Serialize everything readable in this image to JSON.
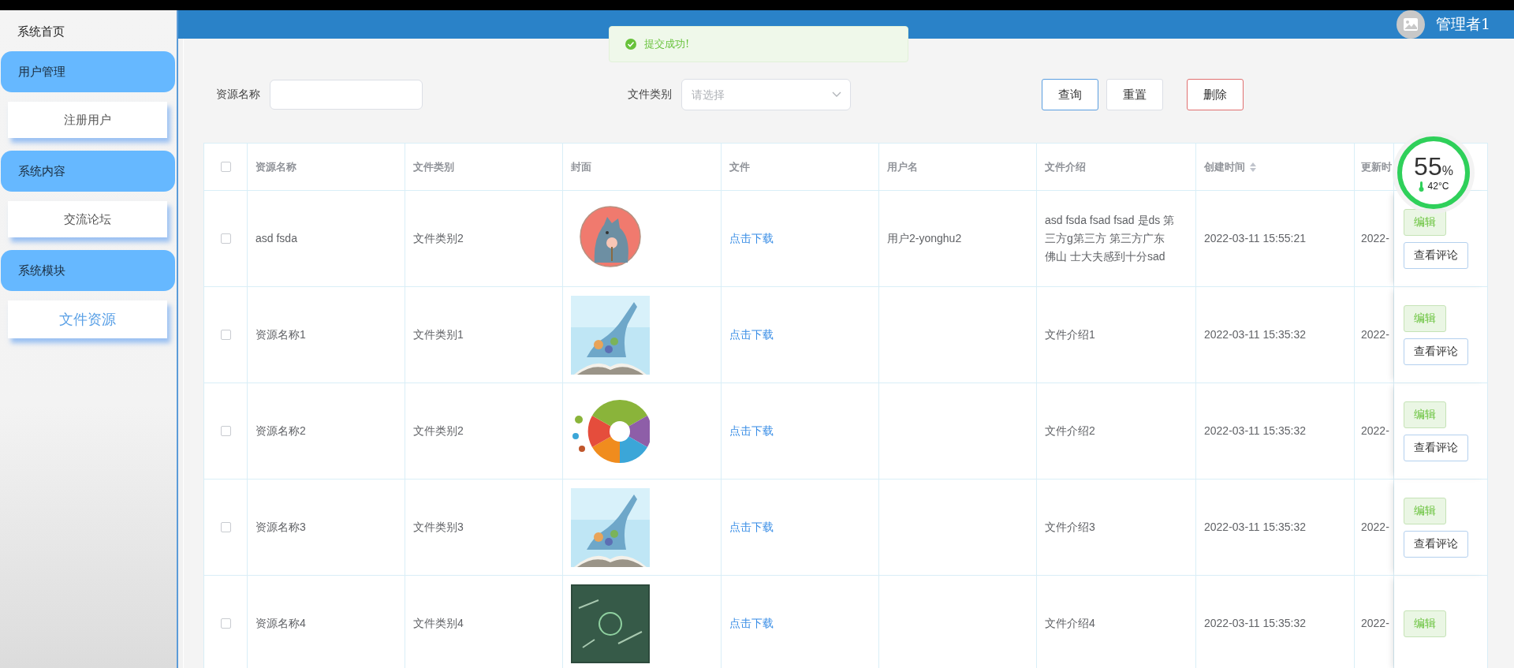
{
  "sidebar": {
    "home": {
      "label": "系统首页"
    },
    "groups": [
      {
        "label": "用户管理",
        "items": [
          {
            "label": "注册用户",
            "selected": false
          }
        ]
      },
      {
        "label": "系统内容",
        "items": [
          {
            "label": "交流论坛",
            "selected": false
          }
        ]
      },
      {
        "label": "系统模块",
        "items": [
          {
            "label": "文件资源",
            "selected": true
          }
        ]
      }
    ]
  },
  "header": {
    "user": "管理者1"
  },
  "toast": {
    "kind": "success",
    "message": "提交成功!"
  },
  "search": {
    "fields": [
      {
        "kind": "text",
        "label": "资源名称"
      },
      {
        "kind": "select",
        "label": "文件类别",
        "placeholder": "请选择"
      }
    ],
    "buttons": [
      {
        "kind": "primary",
        "label": "查询"
      },
      {
        "kind": "default",
        "label": "重置"
      },
      {
        "kind": "danger",
        "label": "删除"
      }
    ]
  },
  "table": {
    "select_all": false,
    "columns": [
      {
        "label": "资源名称",
        "sortable": false
      },
      {
        "label": "文件类别",
        "sortable": false
      },
      {
        "label": "封面",
        "sortable": false
      },
      {
        "label": "文件",
        "sortable": false
      },
      {
        "label": "用户名",
        "sortable": false
      },
      {
        "label": "文件介绍",
        "sortable": false
      },
      {
        "label": "创建时间",
        "sortable": true
      },
      {
        "label": "更新时",
        "sortable": false
      }
    ],
    "rows": [
      {
        "checked": false,
        "name": "asd fsda",
        "category": "文件类别2",
        "cover": {
          "kind": "picture"
        },
        "file_link": "点击下载",
        "username": "用户2-yonghu2",
        "intro": "asd fsda fsad fsad 是ds 第三方g第三方 第三方广东佛山 士大夫感到十分sad",
        "created": "2022-03-11 15:55:21",
        "updated": "2022-",
        "actions": [
          {
            "kind": "edit",
            "label": "编辑"
          },
          {
            "kind": "view",
            "label": "查看评论"
          }
        ]
      },
      {
        "checked": false,
        "name": "资源名称1",
        "category": "文件类别1",
        "cover": {
          "kind": "picture"
        },
        "file_link": "点击下载",
        "intro": "文件介绍1",
        "created": "2022-03-11 15:35:32",
        "updated": "2022-",
        "actions": [
          {
            "kind": "edit",
            "label": "编辑"
          },
          {
            "kind": "view",
            "label": "查看评论"
          }
        ]
      },
      {
        "checked": false,
        "name": "资源名称2",
        "category": "文件类别2",
        "cover": {
          "kind": "picture"
        },
        "file_link": "点击下载",
        "intro": "文件介绍2",
        "created": "2022-03-11 15:35:32",
        "updated": "2022-",
        "actions": [
          {
            "kind": "edit",
            "label": "编辑"
          },
          {
            "kind": "view",
            "label": "查看评论"
          }
        ]
      },
      {
        "checked": false,
        "name": "资源名称3",
        "category": "文件类别3",
        "cover": {
          "kind": "picture"
        },
        "file_link": "点击下载",
        "intro": "文件介绍3",
        "created": "2022-03-11 15:35:32",
        "updated": "2022-",
        "actions": [
          {
            "kind": "edit",
            "label": "编辑"
          },
          {
            "kind": "view",
            "label": "查看评论"
          }
        ]
      },
      {
        "checked": false,
        "name": "资源名称4",
        "category": "文件类别4",
        "cover": {
          "kind": "picture"
        },
        "file_link": "点击下载",
        "intro": "文件介绍4",
        "created": "2022-03-11 15:35:32",
        "updated": "2022-",
        "actions": [
          {
            "kind": "edit",
            "label": "编辑"
          }
        ]
      }
    ]
  },
  "monitor": {
    "value": "55",
    "unit": "%",
    "temperature": "42°C"
  }
}
